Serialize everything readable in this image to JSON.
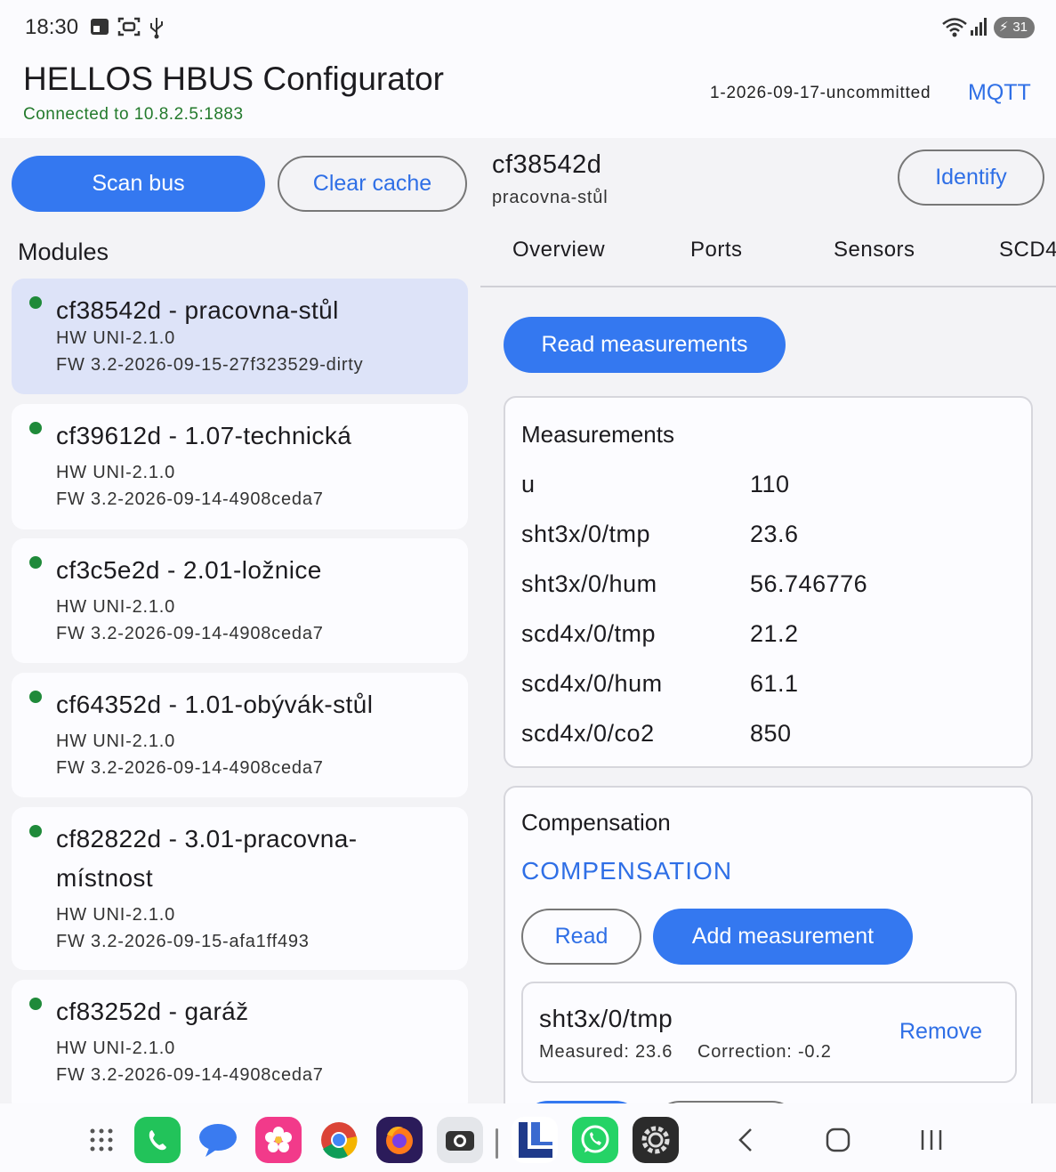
{
  "status_bar": {
    "time": "18:30",
    "battery": "31",
    "icons": [
      "screen-icon",
      "screenshot-icon",
      "usb-icon",
      "wifi-icon",
      "signal-icon",
      "battery-icon"
    ]
  },
  "header": {
    "title": "HELLOS HBUS Configurator",
    "connection": "Connected to 10.8.2.5:1883",
    "version": "1-2026-09-17-uncommitted",
    "mqtt_label": "MQTT"
  },
  "left": {
    "scan_label": "Scan bus",
    "clear_label": "Clear cache",
    "modules_title": "Modules",
    "modules": [
      {
        "name": "cf38542d - pracovna-stůl",
        "hw": "HW UNI-2.1.0",
        "fw": "FW 3.2-2026-09-15-27f323529-dirty",
        "selected": true
      },
      {
        "name": "cf39612d - 1.07-technická",
        "hw": "HW UNI-2.1.0",
        "fw": "FW 3.2-2026-09-14-4908ceda7",
        "selected": false
      },
      {
        "name": "cf3c5e2d - 2.01-ložnice",
        "hw": "HW UNI-2.1.0",
        "fw": "FW 3.2-2026-09-14-4908ceda7",
        "selected": false
      },
      {
        "name": "cf64352d - 1.01-obývák-stůl",
        "hw": "HW UNI-2.1.0",
        "fw": "FW 3.2-2026-09-14-4908ceda7",
        "selected": false
      },
      {
        "name": "cf82822d - 3.01-pracovna-místnost",
        "hw": "HW UNI-2.1.0",
        "fw": "FW 3.2-2026-09-15-afa1ff493",
        "selected": false
      },
      {
        "name": "cf83252d - garáž",
        "hw": "HW UNI-2.1.0",
        "fw": "FW 3.2-2026-09-14-4908ceda7",
        "selected": false
      }
    ]
  },
  "detail": {
    "id": "cf38542d",
    "location": "pracovna-stůl",
    "identify_label": "Identify",
    "tabs": [
      "Overview",
      "Ports",
      "Sensors",
      "SCD4"
    ],
    "read_measurements_label": "Read measurements",
    "measurements_title": "Measurements",
    "measurements": [
      {
        "key": "u",
        "value": "110"
      },
      {
        "key": "sht3x/0/tmp",
        "value": "23.6"
      },
      {
        "key": "sht3x/0/hum",
        "value": "56.746776"
      },
      {
        "key": "scd4x/0/tmp",
        "value": "21.2"
      },
      {
        "key": "scd4x/0/hum",
        "value": "61.1"
      },
      {
        "key": "scd4x/0/co2",
        "value": "850"
      }
    ],
    "compensation": {
      "title": "Compensation",
      "link": "COMPENSATION",
      "read_label": "Read",
      "add_label": "Add measurement",
      "entry": {
        "name": "sht3x/0/tmp",
        "measured": "Measured: 23.6",
        "correction": "Correction: -0.2",
        "remove_label": "Remove"
      }
    }
  },
  "navbar": {
    "apps": [
      "app-drawer-icon",
      "phone-icon",
      "messages-icon",
      "gallery-icon",
      "chrome-icon",
      "firefox-icon",
      "camera-icon",
      "app-icon",
      "whatsapp-icon",
      "settings-icon"
    ],
    "nav": [
      "back-icon",
      "home-icon",
      "recents-icon"
    ]
  },
  "colors": {
    "accent": "#3478f0",
    "link": "#2f6fe6",
    "connected": "#237a2c",
    "selected_module": "#dde3f8",
    "status_dot": "#1f8a3a"
  }
}
